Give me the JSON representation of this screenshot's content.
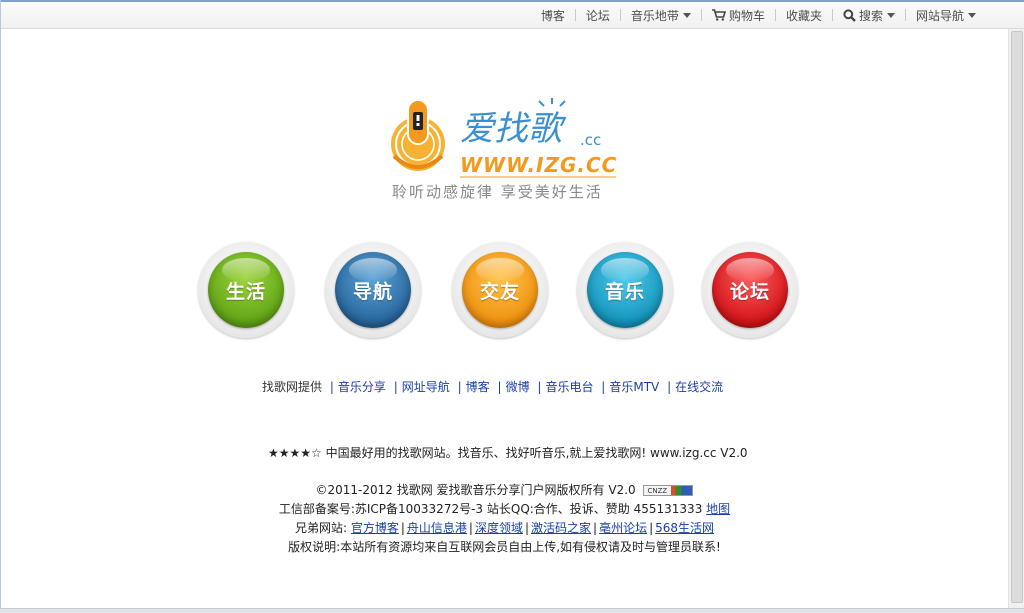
{
  "topnav": {
    "items": [
      {
        "label": "博客"
      },
      {
        "label": "论坛"
      },
      {
        "label": "音乐地带"
      },
      {
        "label": "购物车"
      },
      {
        "label": "收藏夹"
      },
      {
        "label": "搜索"
      },
      {
        "label": "网站导航"
      }
    ]
  },
  "logo": {
    "name": "爱找歌",
    "suffix": ".cc",
    "url_text": "WWW.IZG.CC",
    "slogan": "聆听动感旋律 享受美好生活",
    "colors": {
      "orange": "#f39a1e",
      "blue": "#3b8fd0"
    }
  },
  "buttons": [
    {
      "label": "生活",
      "color": "#6fb51a"
    },
    {
      "label": "导航",
      "color": "#2f7bb7"
    },
    {
      "label": "交友",
      "color": "#f7a21b"
    },
    {
      "label": "音乐",
      "color": "#19a6cf"
    },
    {
      "label": "论坛",
      "color": "#e01f25"
    }
  ],
  "links_row": {
    "prefix": "找歌网提供",
    "links": [
      "音乐分享",
      "网址导航",
      "博客",
      "微博",
      "音乐电台",
      "音乐MTV",
      "在线交流"
    ]
  },
  "tagline": "★★★★☆ 中国最好用的找歌网站。找音乐、找好听音乐,就上爱找歌网! www.izg.cc V2.0",
  "footer": {
    "copyright": "©2011-2012 找歌网   爱找歌音乐分享门户网版权所有  V2.0",
    "cnzz_text": "CNZZ",
    "icp": "工信部备案号:苏ICP备10033272号-3 站长QQ:合作、投诉、赞助  455131333",
    "icp_link": "地图",
    "friends_label": "兄弟网站:",
    "friends": [
      "官方博客",
      "舟山信息港",
      "深度领域",
      "激活码之家",
      "亳州论坛",
      "568生活网"
    ],
    "notice": "版权说明:本站所有资源均来自互联网会员自由上传,如有侵权请及时与管理员联系!"
  }
}
